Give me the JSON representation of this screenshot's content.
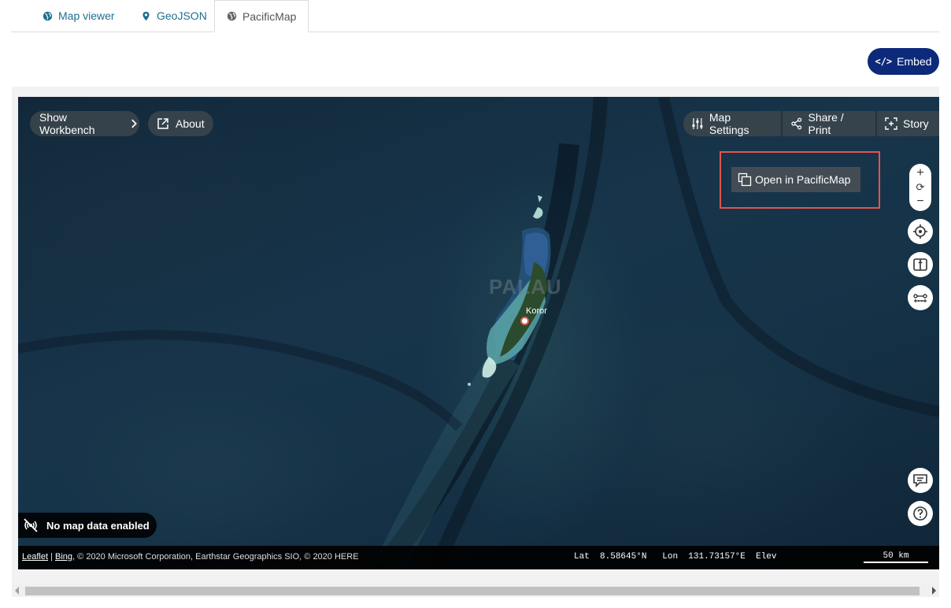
{
  "tabs": [
    {
      "label": "Map viewer",
      "icon": "globe-icon"
    },
    {
      "label": "GeoJSON",
      "icon": "map-pin-icon"
    },
    {
      "label": "PacificMap",
      "icon": "globe-icon",
      "active": true
    }
  ],
  "embed_label": "Embed",
  "map": {
    "show_workbench": "Show Workbench",
    "about": "About",
    "map_settings": "Map Settings",
    "share_print": "Share / Print",
    "story": "Story",
    "open_in": "Open in PacificMap",
    "region_label": "PALAU",
    "city_label": "Koror",
    "zoom_in": "+",
    "zoom_reset": "⟳",
    "zoom_out": "−",
    "no_data": "No map data enabled",
    "attribution": {
      "leaflet": "Leaflet",
      "separator": " | ",
      "bing": "Bing",
      "rest": ", © 2020 Microsoft Corporation, Earthstar Geographics SIO, © 2020 HERE"
    },
    "coords": {
      "lat_label": "Lat",
      "lat_value": "8.58645°N",
      "lon_label": "Lon",
      "lon_value": "131.73157°E",
      "elev_label": "Elev"
    },
    "scale_label": "50 km"
  },
  "colors": {
    "accent": "#0d2a7a",
    "tab_link": "#1d6f91",
    "highlight_border": "#e0554f"
  }
}
